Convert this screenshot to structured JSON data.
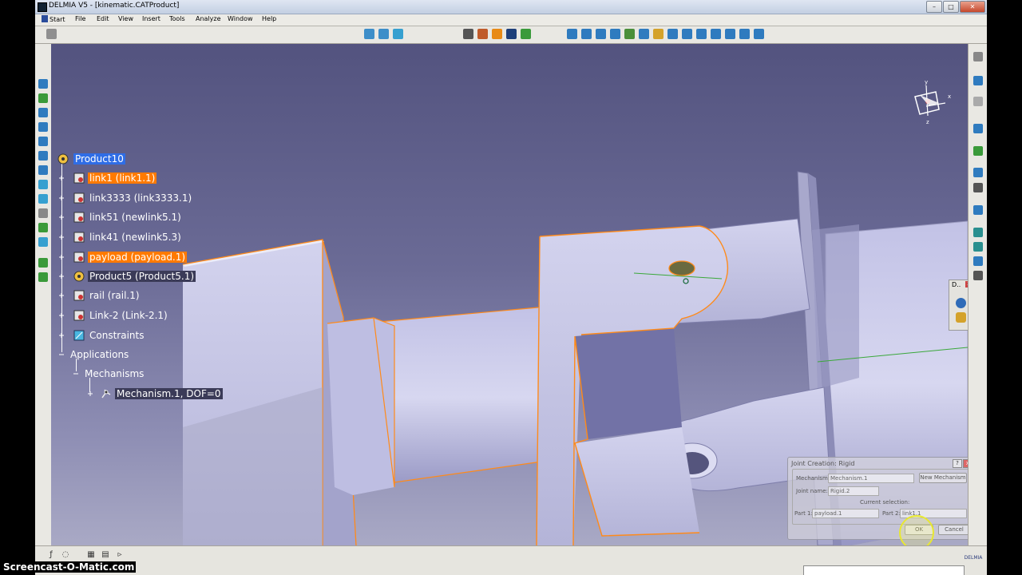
{
  "window": {
    "title": "DELMIA V5 - [kinematic.CATProduct]",
    "minimize": "–",
    "maximize": "□",
    "close": "✕"
  },
  "menu": {
    "start": "Start",
    "items": [
      "File",
      "Edit",
      "View",
      "Insert",
      "Tools",
      "Analyze",
      "Window",
      "Help"
    ]
  },
  "tree": {
    "root": "Product10",
    "children": [
      "link1 (link1.1)",
      "link3333 (link3333.1)",
      "link51 (newlink5.1)",
      "link41 (newlink5.3)",
      "payload (payload.1)",
      "Product5 (Product5.1)",
      "rail (rail.1)",
      "Link-2 (Link-2.1)",
      "Constraints"
    ],
    "applications": "Applications",
    "mechanisms": "Mechanisms",
    "mechanism": "Mechanism.1, DOF=0"
  },
  "dialog": {
    "title": "Joint Creation: Rigid",
    "mechanism_label": "Mechanism:",
    "mechanism_value": "Mechanism.1",
    "new_mechanism": "New Mechanism",
    "joint_name_label": "Joint name:",
    "joint_name_value": "Rigid.2",
    "current_selection": "Current selection:",
    "part1_label": "Part 1:",
    "part1_value": "payload.1",
    "part2_label": "Part 2:",
    "part2_value": "link1.1",
    "ok": "OK",
    "cancel": "Cancel"
  },
  "mini_panel": {
    "title": "D.."
  },
  "compass": {
    "x_label": "x",
    "y_label": "y",
    "z_label": "z"
  },
  "watermark": "Screencast-O-Matic.com",
  "logo": "DELMIA",
  "colors": {
    "accent_blue": "#2f6de6",
    "highlight_orange": "#ff7a00",
    "part_fill": "#c9c9ea",
    "edge_orange": "#ff8a1a"
  }
}
